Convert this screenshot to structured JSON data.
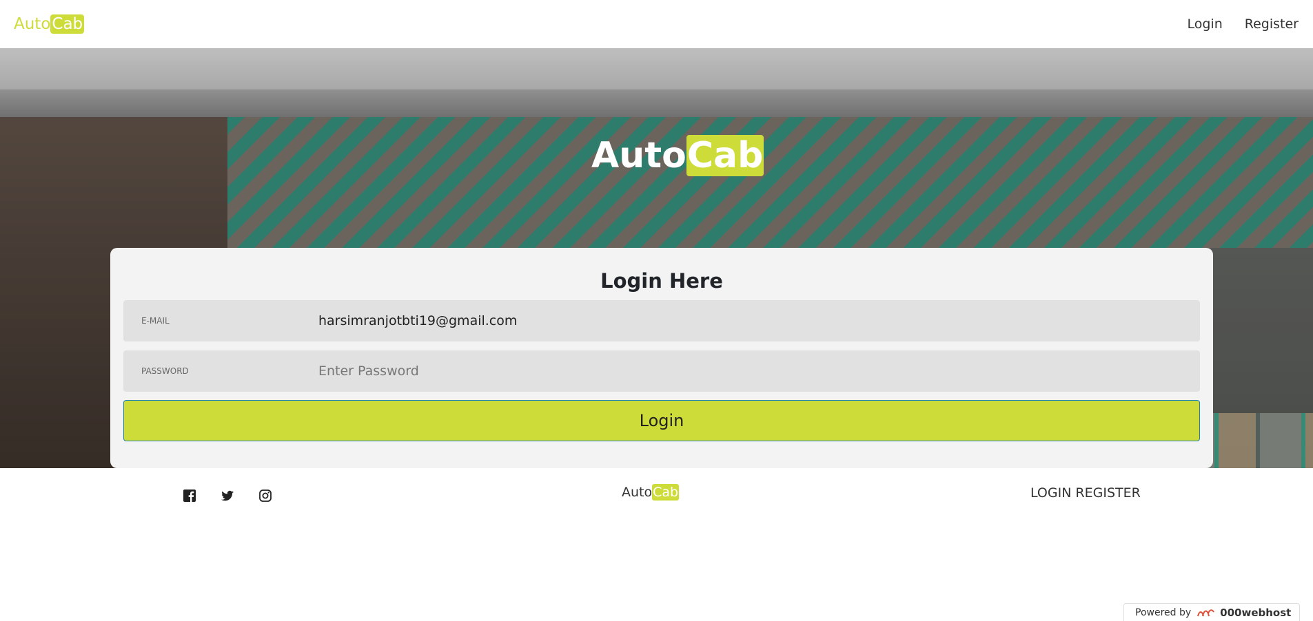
{
  "navbar": {
    "brand_prefix": "Auto",
    "brand_suffix": "Cab",
    "links": [
      "Login",
      "Register"
    ]
  },
  "hero": {
    "logo_prefix": "Auto",
    "logo_suffix": "Cab"
  },
  "login_form": {
    "title": "Login Here",
    "email_label": "E-MAIL",
    "email_value": "harsimranjotbti19@gmail.com",
    "password_label": "PASSWORD",
    "password_placeholder": "Enter Password",
    "submit_label": "Login"
  },
  "footer": {
    "social_icons": [
      "facebook-icon",
      "twitter-icon",
      "instagram-icon"
    ],
    "brand_prefix": "Auto",
    "brand_suffix": "Cab",
    "links": [
      "LOGIN",
      "REGISTER"
    ]
  },
  "badge": {
    "prefix": "Powered by",
    "name": "000webhost"
  },
  "colors": {
    "accent": "#cddc39",
    "button_border": "#1a7fb5"
  }
}
